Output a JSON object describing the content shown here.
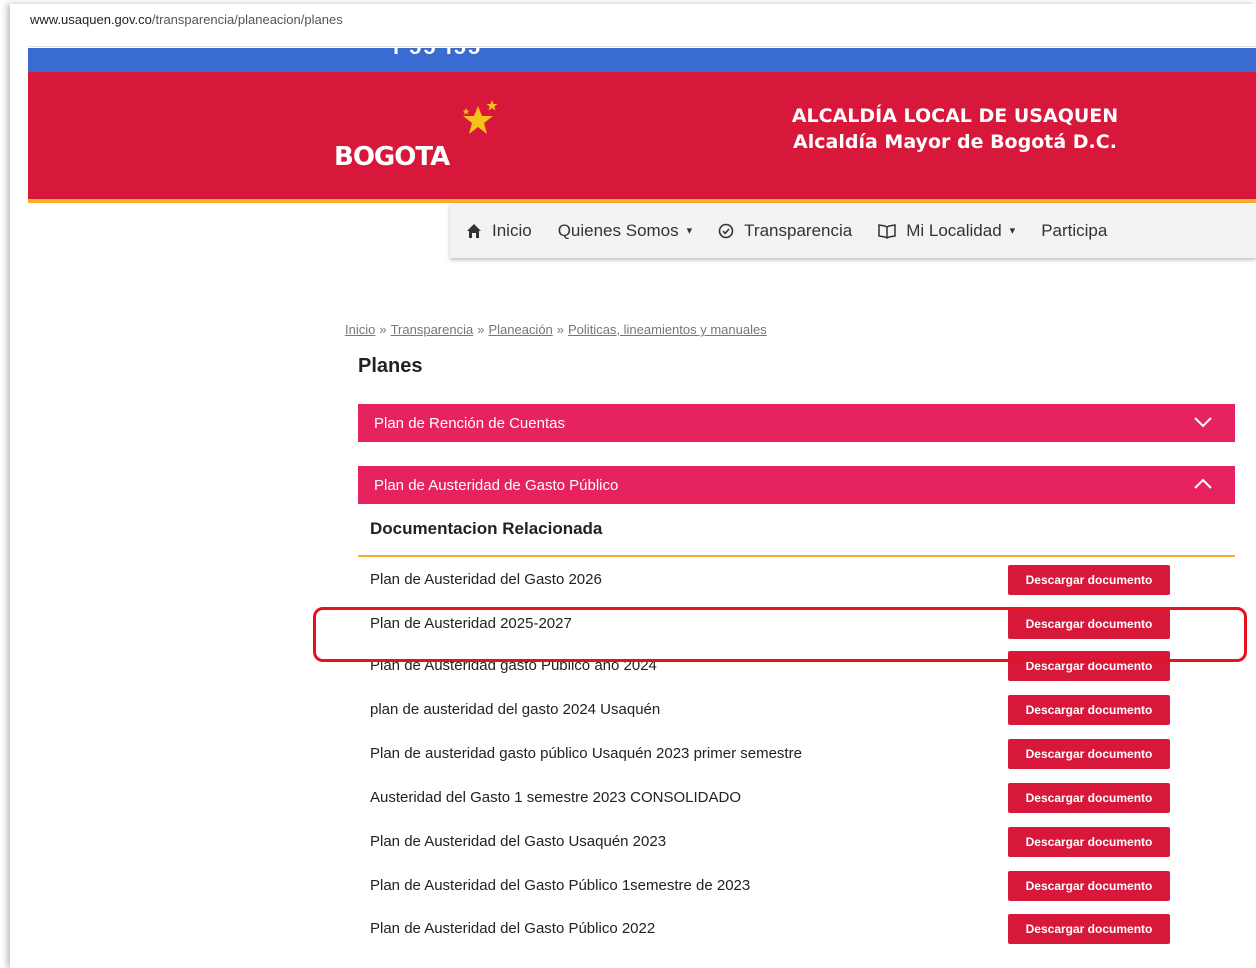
{
  "url": {
    "host": "www.usaquen.gov.co",
    "path": "/transparencia/planeacion/planes"
  },
  "header": {
    "partial_top_text": "ı ɔɔ ıɔɔ",
    "logo_text": "BOGOTA",
    "title_line1": "ALCALDÍA LOCAL DE USAQUEN",
    "title_line2": "Alcaldía Mayor de Bogotá D.C."
  },
  "nav": {
    "items": [
      {
        "label": "Inicio",
        "icon": "home-icon"
      },
      {
        "label": "Quienes Somos",
        "icon": "",
        "dropdown": true
      },
      {
        "label": "Transparencia",
        "icon": "check-circle-icon"
      },
      {
        "label": "Mi Localidad",
        "icon": "book-icon",
        "dropdown": true
      },
      {
        "label": "Participa",
        "icon": ""
      }
    ]
  },
  "breadcrumb": {
    "items": [
      "Inicio",
      "Transparencia",
      "Planeación",
      "Politicas, lineamientos y manuales"
    ],
    "separator": "»"
  },
  "page_title": "Planes",
  "accordion": [
    {
      "label": "Plan de Rención de Cuentas",
      "expanded": false
    },
    {
      "label": "Plan de Austeridad de Gasto Público",
      "expanded": true
    }
  ],
  "documents": {
    "heading": "Documentacion Relacionada",
    "button_label": "Descargar documento",
    "rows": [
      "Plan de Austeridad del Gasto 2026",
      "Plan de Austeridad 2025-2027",
      "Plan de Austeridad gasto Público año 2024",
      "plan de austeridad del gasto 2024 Usaquén",
      "Plan de austeridad gasto público Usaquén 2023 primer semestre",
      "Austeridad del Gasto 1 semestre 2023 CONSOLIDADO",
      "Plan de Austeridad del Gasto Usaquén 2023",
      "Plan de Austeridad del Gasto Público 1semestre de 2023",
      "Plan de Austeridad del Gasto Público 2022"
    ],
    "highlighted_row_index": 1
  },
  "colors": {
    "red": "#d8183a",
    "pink": "#e6235f",
    "blue": "#3a6bd1",
    "yellow": "#f5b02a",
    "highlight": "#e8121e"
  }
}
